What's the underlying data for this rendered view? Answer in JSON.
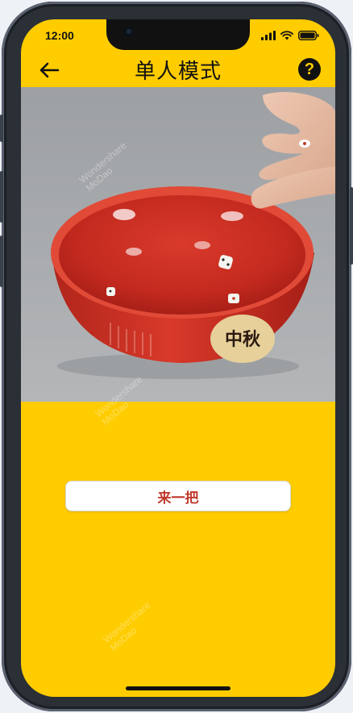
{
  "status_bar": {
    "time": "12:00"
  },
  "header": {
    "title": "单人模式",
    "back_icon": "arrow-left-icon",
    "help_icon": "question-icon",
    "help_glyph": "?"
  },
  "media": {
    "bowl_characters": "中秋"
  },
  "actions": {
    "play_label": "来一把"
  },
  "watermark": {
    "line1": "Wondershare",
    "line2": "MoDao"
  },
  "colors": {
    "background": "#ffcc00",
    "accent": "#c0392b",
    "button_bg": "#ffffff"
  }
}
